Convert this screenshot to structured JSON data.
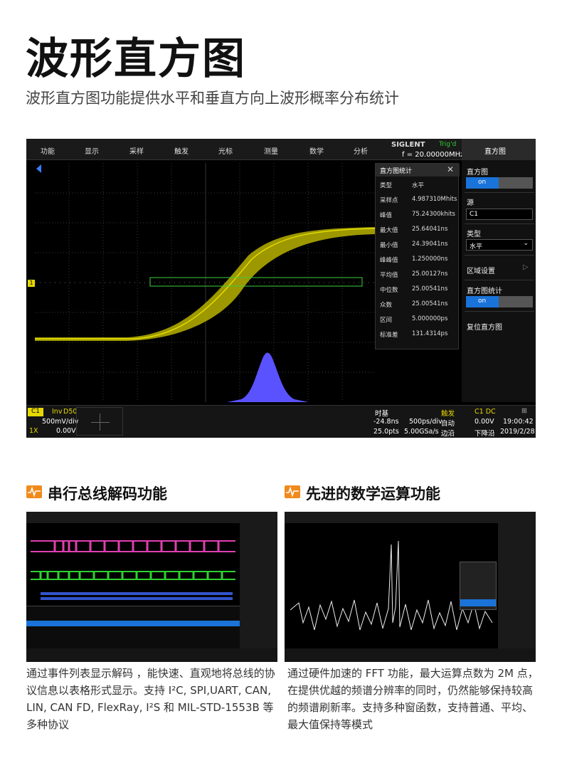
{
  "heading": {
    "title": "波形直方图",
    "subtitle": "波形直方图功能提供水平和垂直方向上波形概率分布统计"
  },
  "scope": {
    "menu": [
      "功能",
      "显示",
      "采样",
      "触发",
      "光标",
      "测量",
      "数学",
      "分析"
    ],
    "brand": "SIGLENT",
    "trig_state": "Trig'd",
    "freq": "f = 20.00000MHz",
    "panel_title": "直方图",
    "stats": {
      "title": "直方图统计",
      "rows": [
        {
          "k": "类型",
          "v": "水平"
        },
        {
          "k": "采样点",
          "v": "4.987310Mhits"
        },
        {
          "k": "峰值",
          "v": "75.24300khits"
        },
        {
          "k": "最大值",
          "v": "25.64041ns"
        },
        {
          "k": "最小值",
          "v": "24.39041ns"
        },
        {
          "k": "峰峰值",
          "v": "1.250000ns"
        },
        {
          "k": "平均值",
          "v": "25.00127ns"
        },
        {
          "k": "中位数",
          "v": "25.00541ns"
        },
        {
          "k": "众数",
          "v": "25.00541ns"
        },
        {
          "k": "区间",
          "v": "5.000000ps"
        },
        {
          "k": "标准差",
          "v": "131.4314ps"
        }
      ]
    },
    "side": {
      "histogram": "直方图",
      "on": "on",
      "source_label": "源",
      "source": "C1",
      "type_label": "类型",
      "type": "水平",
      "region": "区域设置",
      "stats_label": "直方图统计",
      "stats_on": "on",
      "reset": "复位直方图"
    },
    "bottom": {
      "ch": "C1",
      "inv": "Inv",
      "d50": "D50",
      "vdiv": "500mV/div",
      "probe": "1X",
      "offset": "0.00V",
      "tb_label": "时基",
      "tb_delay": "-24.8ns",
      "tb_div": "500ps/div",
      "pts": "25.0pts",
      "rate": "5.00GSa/s",
      "trig_label": "触发",
      "trig_src": "C1 DC",
      "trig_mode": "自动",
      "trig_level": "0.00V",
      "coupling": "边沿",
      "slope": "下降沿",
      "time": "19:00:42",
      "date": "2019/2/28"
    }
  },
  "left_section": {
    "title": "串行总线解码功能",
    "desc": "通过事件列表显示解码 ，能快速、直观地将总线的协议信息以表格形式显示。支持 I²C, SPI,UART, CAN, LIN, CAN FD, FlexRay, I²S 和 MIL-STD-1553B 等多种协议"
  },
  "right_section": {
    "title": "先进的数学运算功能",
    "desc": "通过硬件加速的 FFT 功能，最大运算点数为 2M 点，在提供优越的频谱分辨率的同时，仍然能够保持较高的频谱刷新率。支持多种窗函数，支持普通、平均、最大值保持等模式"
  },
  "colors": {
    "waveform": "#c8c200",
    "histogram": "#5a52ff",
    "accent": "#f08a1c",
    "on": "#1a73d9"
  }
}
